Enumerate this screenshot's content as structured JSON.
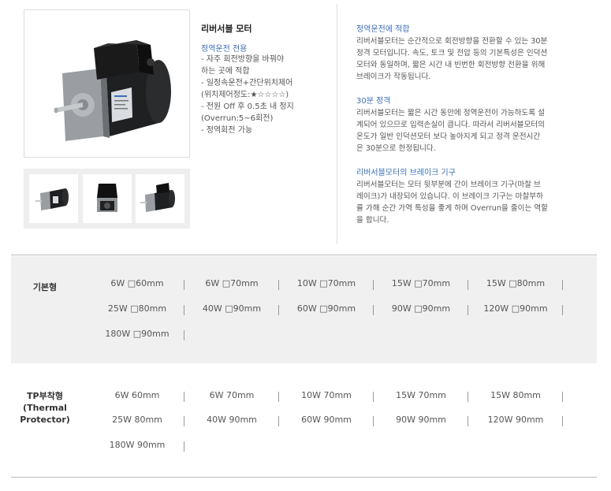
{
  "product": {
    "title": "리버서블 모터",
    "features_title": "정역운전 전용",
    "features": [
      [
        "- 자주 회전방향을 바꿔야",
        "  하는 곳에 적합"
      ],
      [
        "- 일정속운전+간단위치제어",
        "  (위치제어정도:★☆☆☆☆)"
      ],
      [
        "- 전원 Off 후 0.5초 내 정지",
        "  (Overrun:5~6회전)"
      ],
      [
        "- 정역회전 가능"
      ]
    ],
    "main_image_icon": "reversible-motor-photo",
    "thumbnails": [
      "motor-thumb-icon",
      "motor-thumb-icon",
      "motor-thumb-icon"
    ]
  },
  "descriptions": [
    {
      "heading": "정역운전에 적합",
      "body": "리버서블모터는 순간적으로 회전방향을 전환할 수 있는 30분\n정격 모터입니다. 속도, 토크 및 전압 등의 기본특성은 인덕션\n모터와 동일하며, 짧은 시간 내 빈번한 회전방향 전환을 위해\n브레이크가 작동됩니다."
    },
    {
      "heading": "30분 정격",
      "body": "리버서블모터는 짧은 시간 동안에 정역운전이 가능하도록 설\n계되어 있으므로 입력손실이 큽니다. 따라서 리버서블모터의\n온도가 일반 인덕션모터 보다 높아지게 되고 정격 운전시간\n은 30분으로 한정됩니다."
    },
    {
      "heading": "리버서블모터의 브레이크 기구",
      "body": "리버서블모터는 모터 뒷부분에 간이 브레이크 기구(마찰 브\n레이크)가 내장되어 있습니다. 이 브레이크 기구는 마찰부하\n를 가해 순간 가역 특성을 좋게 하며 Overrun을 줄이는 역할\n을 합니다."
    }
  ],
  "spec_table": {
    "rows": [
      {
        "label": "기본형",
        "items": [
          "6W □60mm",
          "6W □70mm",
          "10W □70mm",
          "15W □70mm",
          "15W □80mm",
          "25W □80mm",
          "40W □90mm",
          "60W □90mm",
          "90W □90mm",
          "120W □90mm",
          "180W □90mm"
        ]
      },
      {
        "label": "TP부착형\n(Thermal\nProtector)",
        "items": [
          "6W 60mm",
          "6W 70mm",
          "10W 70mm",
          "15W 70mm",
          "15W 80mm",
          "25W 80mm",
          "40W 90mm",
          "60W 90mm",
          "90W 90mm",
          "120W 90mm",
          "180W 90mm"
        ]
      }
    ]
  }
}
